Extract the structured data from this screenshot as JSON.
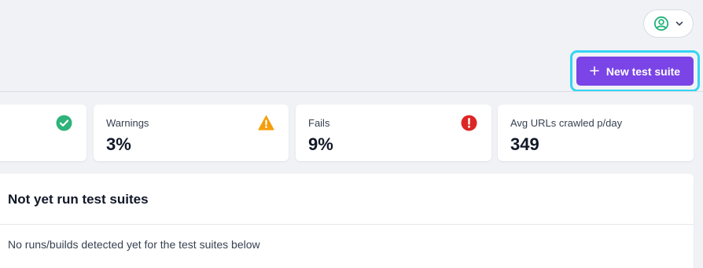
{
  "header": {
    "user_menu": {
      "avatar_icon": "user-circle-icon",
      "chevron_icon": "chevron-down-icon",
      "accent": "#22b27a"
    },
    "new_suite_button": {
      "icon": "plus-icon",
      "label": "New test suite",
      "color": "#7a44e6",
      "focus_ring": "#35d4f3"
    }
  },
  "stats": [
    {
      "label": "",
      "value": "",
      "icon": "check-circle-icon",
      "color": "#2fb37a"
    },
    {
      "label": "Warnings",
      "value": "3%",
      "icon": "warning-triangle-icon",
      "color": "#f59e0b"
    },
    {
      "label": "Fails",
      "value": "9%",
      "icon": "error-circle-icon",
      "color": "#dc2626"
    },
    {
      "label": "Avg URLs crawled p/day",
      "value": "349",
      "icon": "",
      "color": ""
    }
  ],
  "not_run_panel": {
    "title": "Not yet run test suites",
    "message": "No runs/builds detected yet for the test suites below"
  }
}
